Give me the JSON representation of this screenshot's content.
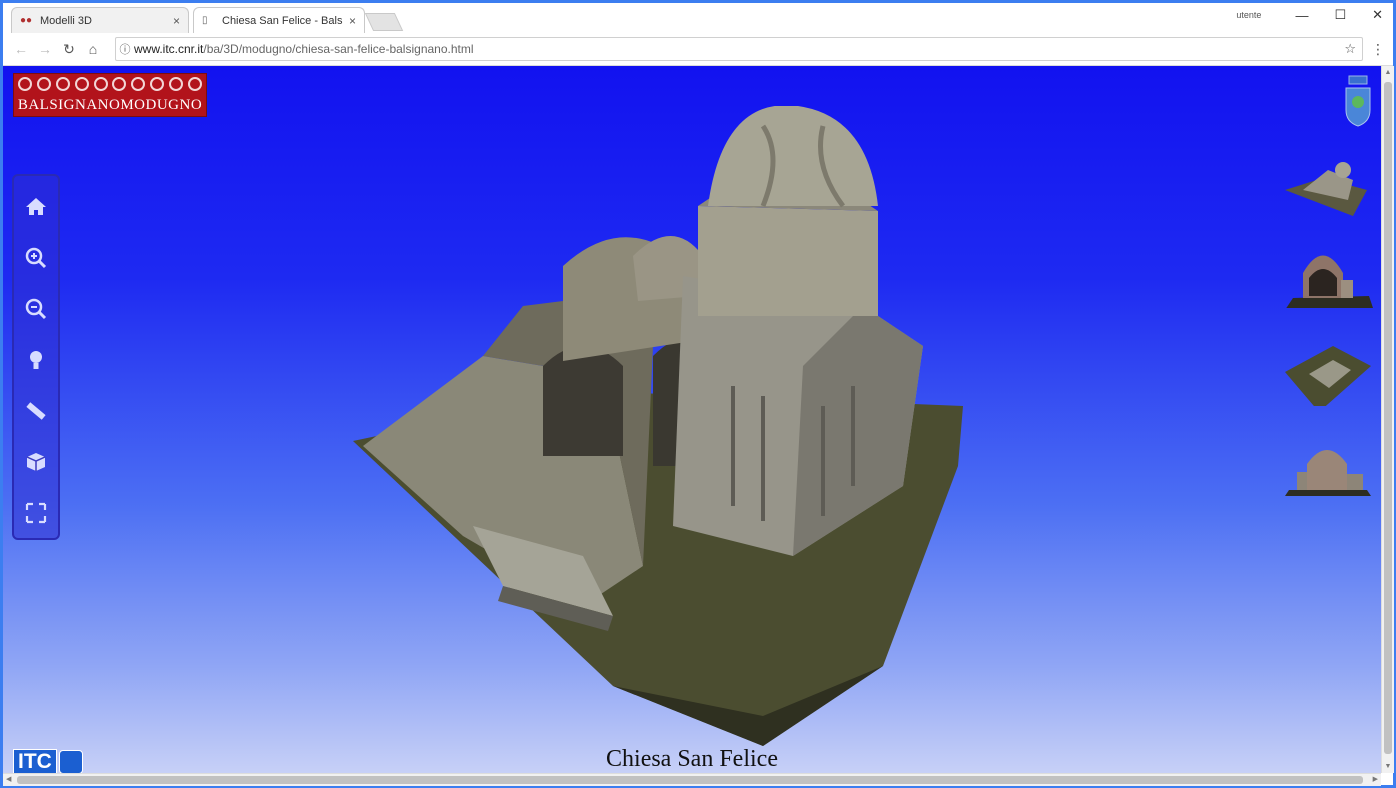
{
  "browser": {
    "tabs": [
      {
        "title": "Modelli 3D",
        "close": "×",
        "favicon": "itc-favicon-icon"
      },
      {
        "title": "Chiesa San Felice - Balsi",
        "close": "×",
        "favicon": "page-icon",
        "active": true
      }
    ],
    "user_badge": "utente",
    "controls": {
      "minimize": "—",
      "maximize": "☐",
      "close": "✕"
    },
    "nav": {
      "back": "←",
      "forward": "→",
      "reload": "↻",
      "home": "⌂"
    },
    "url_host": "www.itc.cnr.it",
    "url_path": "/ba/3D/modugno/chiesa-san-felice-balsignano.html",
    "bookmark": "☆",
    "menu": "⋮"
  },
  "viewer": {
    "logo_text": "BALSIGNANOMODUGNO",
    "tools": [
      {
        "name": "home-icon"
      },
      {
        "name": "zoom-in-icon"
      },
      {
        "name": "zoom-out-icon"
      },
      {
        "name": "light-icon"
      },
      {
        "name": "measure-icon"
      },
      {
        "name": "section-cube-icon"
      },
      {
        "name": "fullscreen-icon"
      }
    ],
    "thumbnails": [
      {
        "name": "view-thumbnail-1"
      },
      {
        "name": "view-thumbnail-2"
      },
      {
        "name": "view-thumbnail-3"
      },
      {
        "name": "view-thumbnail-4"
      }
    ],
    "title": "Chiesa San Felice",
    "footer_logo": "ITC"
  },
  "colors": {
    "sky_top": "#1212f0",
    "sky_bottom": "#c7d0f7",
    "logo_red": "#b2131b",
    "frame_blue": "#3c7ef0"
  }
}
